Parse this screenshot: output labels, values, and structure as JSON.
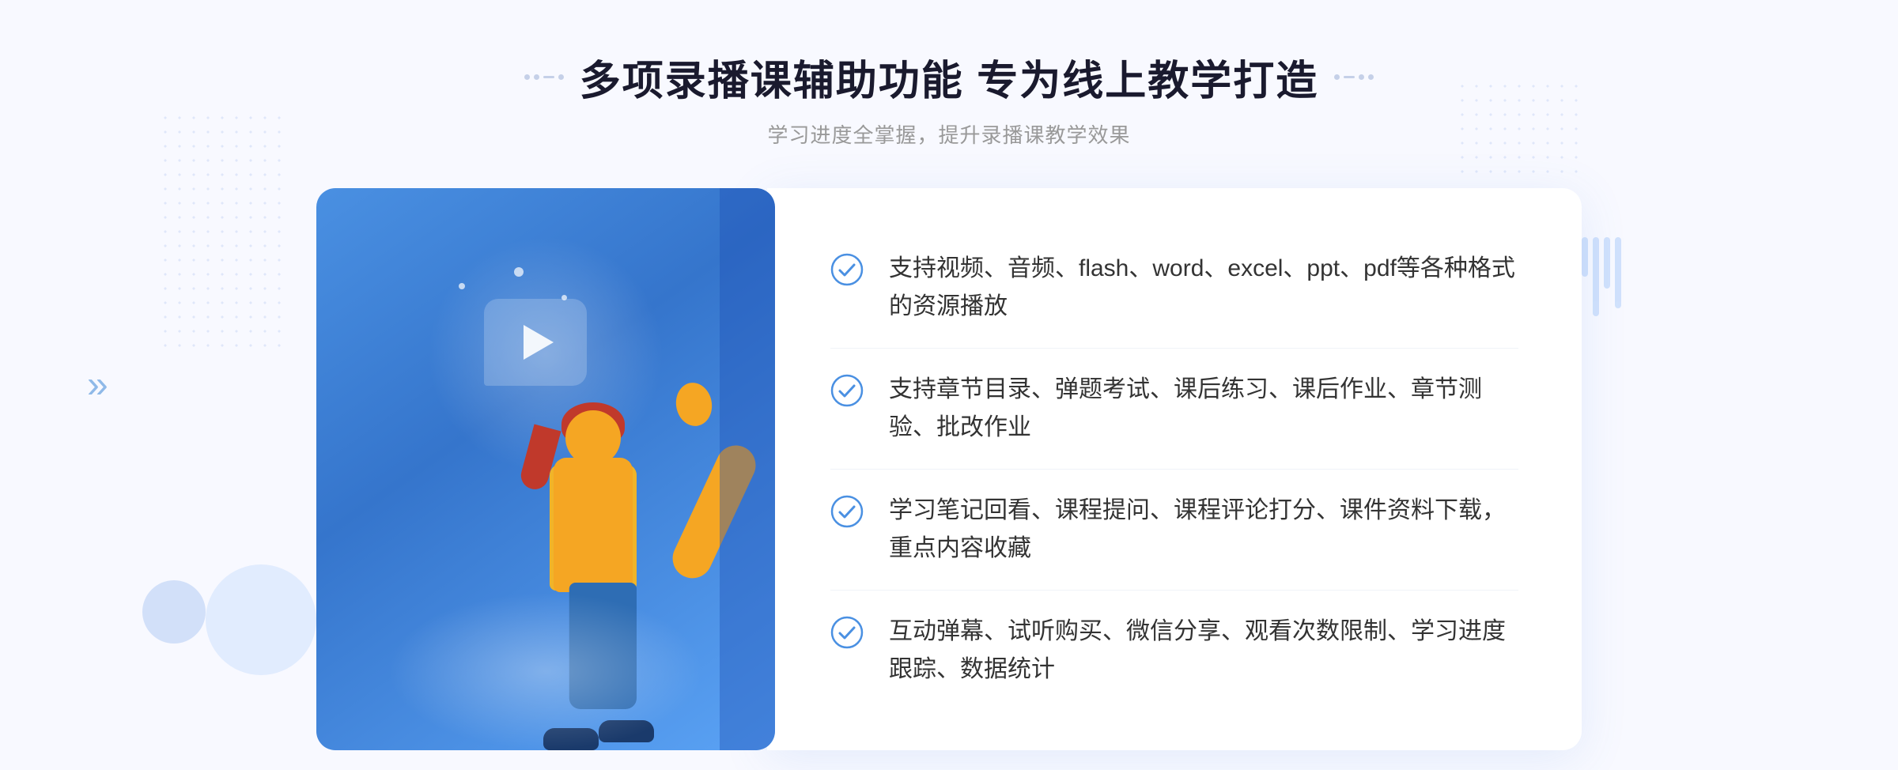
{
  "header": {
    "title": "多项录播课辅助功能 专为线上教学打造",
    "subtitle": "学习进度全掌握，提升录播课教学效果",
    "deco_left": "❮❮",
    "deco_right": "❯❯"
  },
  "features": [
    {
      "id": 1,
      "text": "支持视频、音频、flash、word、excel、ppt、pdf等各种格式的资源播放"
    },
    {
      "id": 2,
      "text": "支持章节目录、弹题考试、课后练习、课后作业、章节测验、批改作业"
    },
    {
      "id": 3,
      "text": "学习笔记回看、课程提问、课程评论打分、课件资料下载，重点内容收藏"
    },
    {
      "id": 4,
      "text": "互动弹幕、试听购买、微信分享、观看次数限制、学习进度跟踪、数据统计"
    }
  ],
  "colors": {
    "primary": "#4a90e2",
    "dark_blue": "#2e6db4",
    "text_dark": "#1a1a2e",
    "text_gray": "#999999",
    "check_color": "#4a90e2"
  }
}
